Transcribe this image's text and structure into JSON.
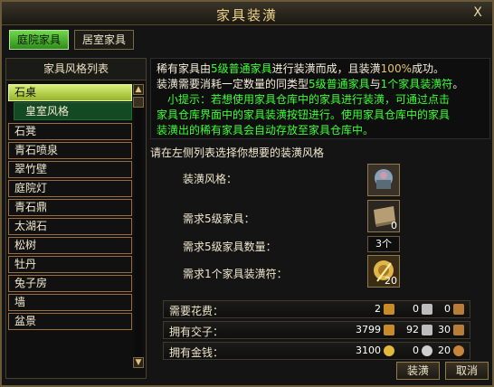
{
  "window": {
    "title": "家具装潢",
    "close_label": "X"
  },
  "tabs": [
    {
      "label": "庭院家具",
      "active": true
    },
    {
      "label": "居室家具",
      "active": false
    }
  ],
  "left_panel": {
    "header": "家具风格列表",
    "items": [
      {
        "label": "石桌",
        "active": true
      },
      {
        "label": "皇室风格",
        "sub": true
      },
      {
        "label": "石凳"
      },
      {
        "label": "青石喷泉"
      },
      {
        "label": "翠竹壁"
      },
      {
        "label": "庭院灯"
      },
      {
        "label": "青石鼎"
      },
      {
        "label": "太湖石"
      },
      {
        "label": "松树"
      },
      {
        "label": "牡丹"
      },
      {
        "label": "兔子房"
      },
      {
        "label": "墙"
      },
      {
        "label": "盆景"
      }
    ]
  },
  "info": {
    "line1_a": "稀有家具由",
    "line1_b": "5级普通家具",
    "line1_c": "进行装潢而成，且装潢",
    "line1_d": "100%",
    "line1_e": "成功。",
    "line2_a": "装潢需要消耗一定数量的同类型",
    "line2_b": "5级普通家具",
    "line2_c": "与",
    "line2_d": "1个家具装潢符",
    "line2_e": "。",
    "line3": "　小提示：若想使用家具仓库中的家具进行装潢，可通过点击",
    "line4": "家具仓库界面中的家具装潢按钮进行。使用家具仓库中的家具",
    "line5": "装潢出的稀有家具会自动存放至家具仓库中。"
  },
  "prompt": "请在左侧列表选择你想要的装潢风格",
  "fields": {
    "style_label": "装潢风格：",
    "required_furniture_label": "需求5级家具：",
    "required_qty_label": "需求5级家具数量：",
    "required_talisman_label": "需求1个家具装潢符：",
    "required_furniture_count": "0",
    "required_qty_value": "3个",
    "talisman_count": "20"
  },
  "costs": {
    "need_label": "需要花费：",
    "need_values": [
      "2",
      "0",
      "0"
    ],
    "jiaozi_label": "拥有交子：",
    "jiaozi_values": [
      "3799",
      "92",
      "30"
    ],
    "gold_label": "拥有金钱：",
    "gold_values": [
      "3100",
      "0",
      "20"
    ]
  },
  "buttons": {
    "decorate": "装潢",
    "cancel": "取消"
  },
  "colors": {
    "accent_green": "#3cff35",
    "title_gold": "#f0d38a",
    "frame": "#6b5a3a"
  }
}
